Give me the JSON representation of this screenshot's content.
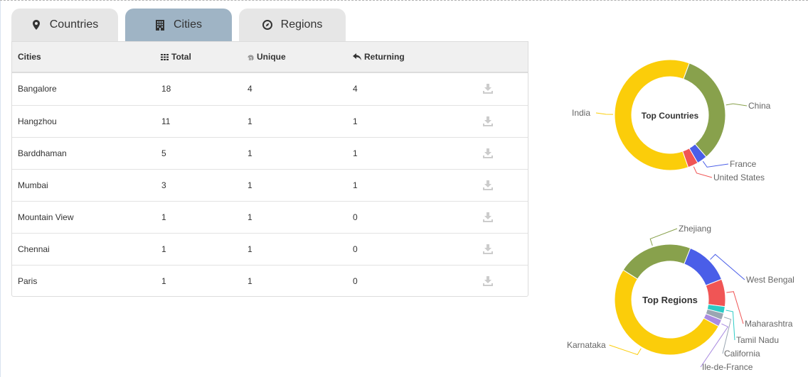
{
  "tabs": [
    {
      "label": "Countries",
      "icon": "map-marker-icon",
      "active": false
    },
    {
      "label": "Cities",
      "icon": "building-icon",
      "active": true
    },
    {
      "label": "Regions",
      "icon": "compass-icon",
      "active": false
    }
  ],
  "table": {
    "headers": {
      "cities": "Cities",
      "total": "Total",
      "unique": "Unique",
      "returning": "Returning"
    },
    "header_icons": {
      "total": "grid-icon",
      "unique": "fingerprint-icon",
      "returning": "reply-icon"
    },
    "rows": [
      {
        "city": "Bangalore",
        "total": "18",
        "unique": "4",
        "returning": "4"
      },
      {
        "city": "Hangzhou",
        "total": "11",
        "unique": "1",
        "returning": "1"
      },
      {
        "city": "Barddhaman",
        "total": "5",
        "unique": "1",
        "returning": "1"
      },
      {
        "city": "Mumbai",
        "total": "3",
        "unique": "1",
        "returning": "1"
      },
      {
        "city": "Mountain View",
        "total": "1",
        "unique": "1",
        "returning": "0"
      },
      {
        "city": "Chennai",
        "total": "1",
        "unique": "1",
        "returning": "0"
      },
      {
        "city": "Paris",
        "total": "1",
        "unique": "1",
        "returning": "0"
      }
    ],
    "row_action_icon": "download-icon"
  },
  "colors": {
    "tab_active": "#9fb4c5",
    "tab_inactive": "#e6e6e6"
  },
  "chart_data": [
    {
      "type": "pie",
      "title": "Top Countries",
      "slices": [
        {
          "label": "India",
          "value": 61,
          "color": "#fbcd0a"
        },
        {
          "label": "China",
          "value": 33,
          "color": "#88a14c"
        },
        {
          "label": "France",
          "value": 3,
          "color": "#4a5ee8"
        },
        {
          "label": "United States",
          "value": 3,
          "color": "#f05555"
        }
      ]
    },
    {
      "type": "pie",
      "title": "Top Regions",
      "slices": [
        {
          "label": "Karnataka",
          "value": 51,
          "color": "#fbcd0a"
        },
        {
          "label": "Zhejiang",
          "value": 22,
          "color": "#88a14c"
        },
        {
          "label": "West Bengal",
          "value": 13,
          "color": "#4a5ee8"
        },
        {
          "label": "Maharashtra",
          "value": 8,
          "color": "#f05555"
        },
        {
          "label": "Tamil Nadu",
          "value": 2,
          "color": "#2ccbc6"
        },
        {
          "label": "California",
          "value": 2,
          "color": "#9aa6b2"
        },
        {
          "label": "Ile-de-France",
          "value": 2,
          "color": "#a98be0"
        }
      ]
    }
  ]
}
